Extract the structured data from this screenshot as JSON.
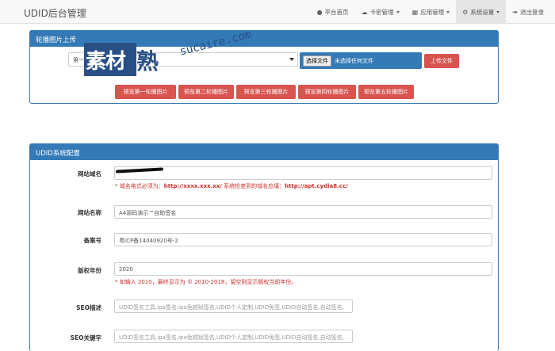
{
  "navbar": {
    "brand": "UDID后台管理",
    "items": [
      {
        "label": "平台首页",
        "icon": "user-icon",
        "dropdown": false
      },
      {
        "label": "卡密管理",
        "icon": "cloud-icon",
        "dropdown": true
      },
      {
        "label": "应用管理",
        "icon": "list-icon",
        "dropdown": true
      },
      {
        "label": "系统设置",
        "icon": "gear-icon",
        "dropdown": true,
        "active": true
      },
      {
        "label": "退出登录",
        "icon": "logout-icon",
        "dropdown": false
      }
    ]
  },
  "banner_panel": {
    "title": "轮播图片上传",
    "select_value": "第一",
    "file_button": "选择文件",
    "file_status": "未选择任何文件",
    "upload_button": "上传文件",
    "preview_buttons": [
      "预览第一轮播图片",
      "预览第二轮播图片",
      "预览第三轮播图片",
      "预览第四轮播图片",
      "预览第五轮播图片"
    ]
  },
  "config_panel": {
    "title": "UDID系统配置",
    "domain": {
      "label": "网站域名",
      "hint_prefix": "* 域名格式必须为：",
      "hint_format": "http://xxxx.xxx.xx/",
      "hint_middle": " 系统检查到的域名应填：",
      "hint_detected": "http://apt.cydia8.cc/"
    },
    "site_name": {
      "label": "网站名称",
      "value": "A4源码演示™自助签名"
    },
    "icp": {
      "label": "备案号",
      "value": "粤ICP备14040920号-2"
    },
    "copyright": {
      "label": "版权年份",
      "value": "2020",
      "hint": "* 如输入 2010，最终显示为 © 2010-2018，留空则显示版权当前年份。"
    },
    "seo_desc": {
      "label": "SEO描述",
      "placeholder": "UDID签名工具,ipa签名,ipa免越狱签名,UDID个人定制,UDID免签,UDID自动签名,自动签名,"
    },
    "seo_keywords": {
      "label": "SEO关键字",
      "placeholder": "UDID签名工具,ipa签名,ipa免越狱签名,UDID个人定制,UDID免签,UDID自动签名,自动签名,"
    }
  },
  "watermark": {
    "logo_text": "素材",
    "logo_text2": "熟",
    "domain": "sucaire.com"
  },
  "colors": {
    "primary": "#337ab7",
    "danger": "#d9534f",
    "hint": "#c9302c"
  }
}
